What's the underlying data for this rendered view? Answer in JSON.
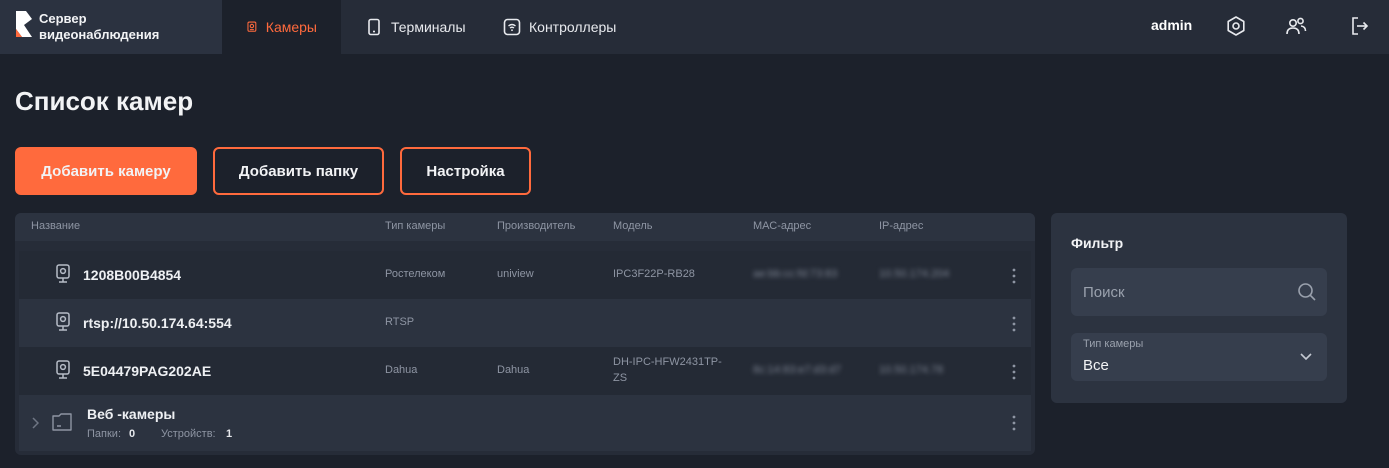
{
  "app": {
    "title_line1": "Сервер",
    "title_line2": "видеонаблюдения",
    "accent": "#ff6a3d"
  },
  "nav": {
    "tabs": [
      {
        "label": "Камеры",
        "icon": "camera-icon",
        "active": true
      },
      {
        "label": "Терминалы",
        "icon": "tablet-icon",
        "active": false
      },
      {
        "label": "Контроллеры",
        "icon": "controller-icon",
        "active": false
      }
    ],
    "user": "admin",
    "icons": [
      "settings-icon",
      "users-icon",
      "logout-icon"
    ]
  },
  "page": {
    "title": "Список камер",
    "buttons": {
      "add_camera": "Добавить камеру",
      "add_folder": "Добавить папку",
      "settings": "Настройка"
    }
  },
  "table": {
    "columns": [
      "Название",
      "Тип камеры",
      "Производитель",
      "Модель",
      "МАС-адрес",
      "IP-адрес"
    ],
    "rows": [
      {
        "name": "1208B00B4854",
        "type": "Ростелеком",
        "vendor": "uniview",
        "model": "IPC3F22P-RB28",
        "mac": "ae:bb:cc:fd:73:83",
        "ip": "10.50.174.204"
      },
      {
        "name": "rtsp://10.50.174.64:554",
        "type": "RTSP",
        "vendor": "",
        "model": "",
        "mac": "",
        "ip": ""
      },
      {
        "name": "5E04479PAG202AE",
        "type": "Dahua",
        "vendor": "Dahua",
        "model_line1": "DH-IPC-HFW2431TP-",
        "model_line2": "ZS",
        "mac": "8c:14:83:e7:d3:d7",
        "ip": "10.50.174.78"
      }
    ],
    "folder": {
      "name": "Веб -камеры",
      "folders_label": "Папки:",
      "folders_count": "0",
      "devices_label": "Устройств:",
      "devices_count": "1"
    }
  },
  "filter": {
    "title": "Фильтр",
    "search_placeholder": "Поиск",
    "camera_type_label": "Тип камеры",
    "camera_type_value": "Все"
  }
}
